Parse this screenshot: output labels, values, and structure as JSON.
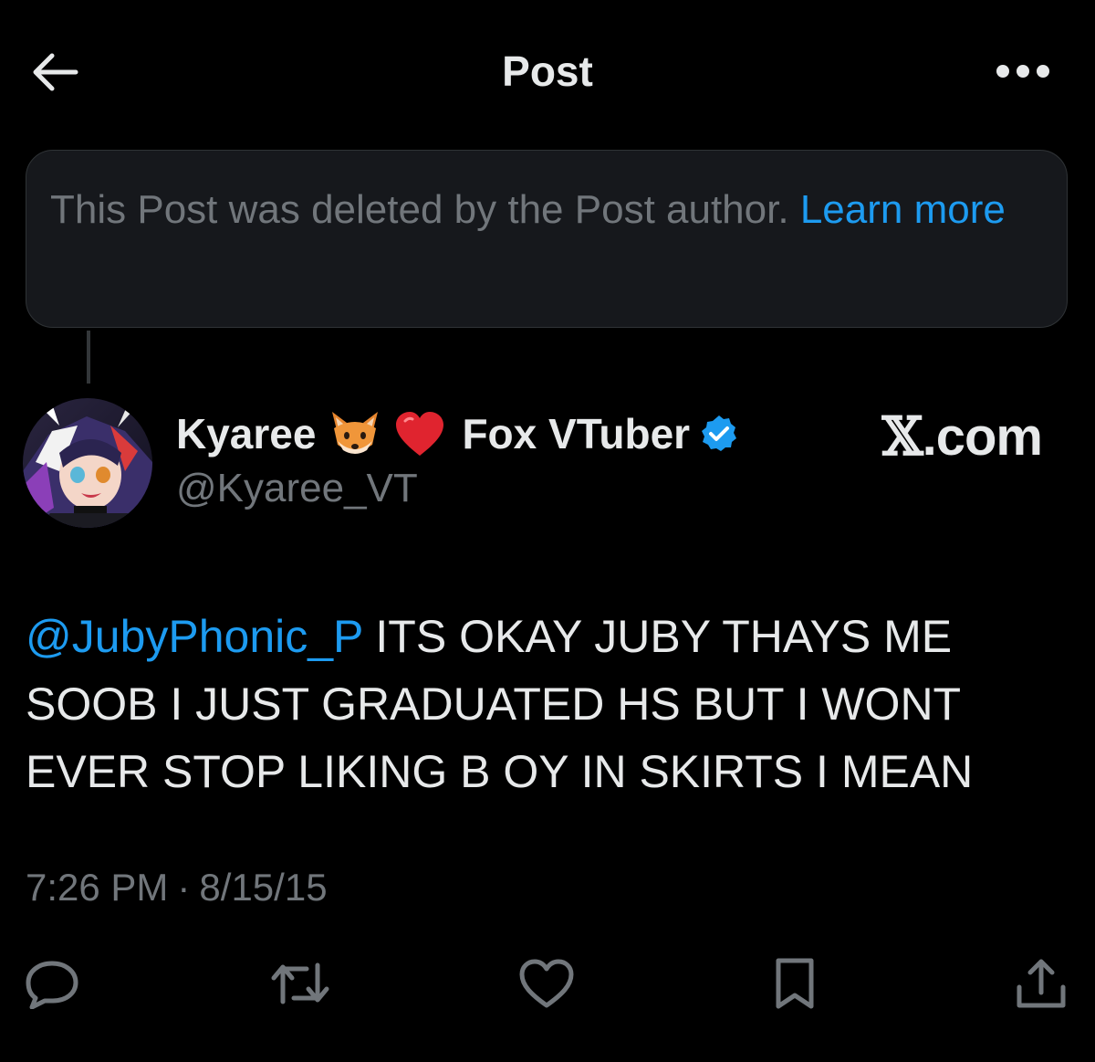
{
  "header": {
    "title": "Post",
    "back_icon": "arrow-left-icon",
    "more_icon": "more-horizontal-icon"
  },
  "deleted_notice": {
    "text": "This Post was deleted by the Post author.",
    "link_label": "Learn more"
  },
  "author": {
    "name_part1": "Kyaree",
    "emoji_1": "fox-face-emoji",
    "emoji_2": "red-heart-emoji",
    "name_part2": "Fox VTuber",
    "verified_icon": "verified-badge-icon",
    "handle": "@Kyaree_VT"
  },
  "watermark": {
    "x_glyph": "𝕏",
    "suffix": ".com"
  },
  "post": {
    "mention": "@JubyPhonic_P",
    "text": " ITS OKAY JUBY THAYS ME SOOB I JUST GRADUATED HS BUT I WONT EVER STOP LIKING B OY IN SKIRTS I MEAN",
    "time": "7:26 PM",
    "separator": "·",
    "date": "8/15/15"
  },
  "actions": [
    {
      "icon": "reply-icon"
    },
    {
      "icon": "repost-icon"
    },
    {
      "icon": "like-icon"
    },
    {
      "icon": "bookmark-icon"
    },
    {
      "icon": "share-icon"
    }
  ],
  "colors": {
    "background": "#000000",
    "text_primary": "#e7e9ea",
    "text_secondary": "#71767b",
    "accent": "#1d9bf0",
    "notice_bg": "#16181c"
  }
}
